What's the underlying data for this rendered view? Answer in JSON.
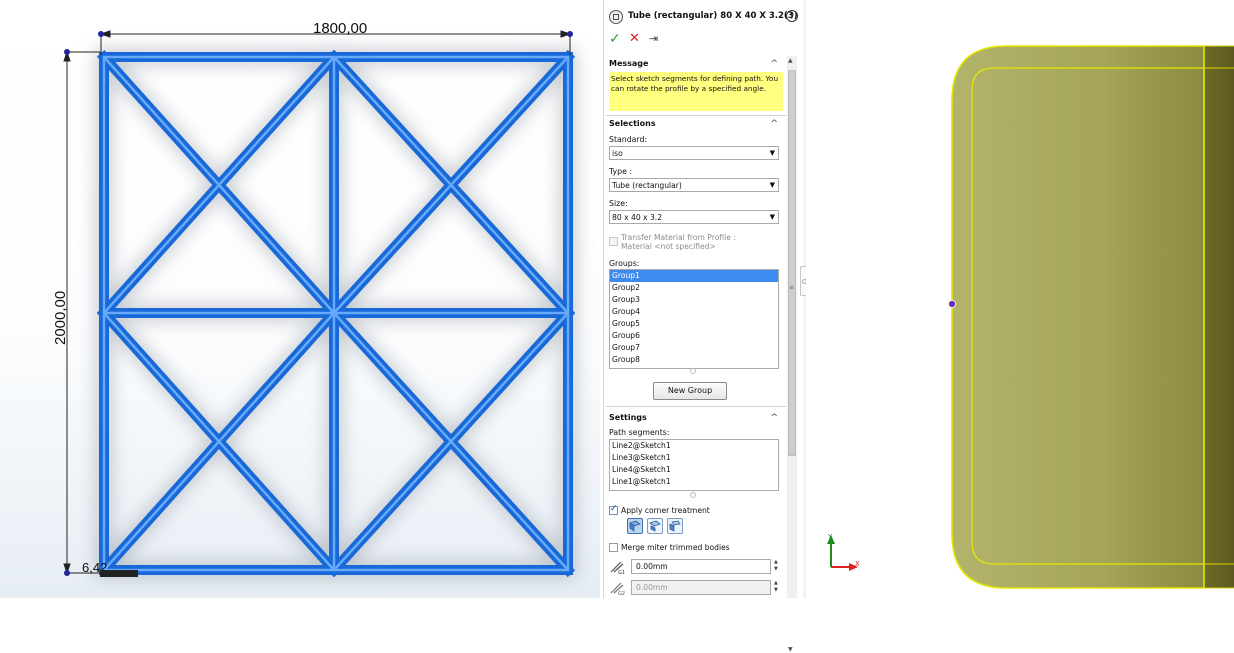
{
  "left_view": {
    "dimension_width": "1800,00",
    "dimension_height": "2000,00",
    "dimension_small": "6,42"
  },
  "property_manager": {
    "title": "Tube (rectangular) 80 X 40 X 3.2(3)",
    "help_symbol": "?",
    "ok_symbol": "✓",
    "cancel_symbol": "✕",
    "pin_symbol": "⇥",
    "message": {
      "heading": "Message",
      "text": "Select sketch segments for defining path. You can rotate the profile by a specified angle."
    },
    "selections": {
      "heading": "Selections",
      "standard_label": "Standard:",
      "standard_value": "iso",
      "type_label": "Type :",
      "type_value": "Tube (rectangular)",
      "size_label": "Size:",
      "size_value": "80 x 40 x 3.2",
      "transfer_material_label": "Transfer Material from Profile :",
      "transfer_material_sub": "Material <not specified>",
      "groups_label": "Groups:",
      "groups": [
        "Group1",
        "Group2",
        "Group3",
        "Group4",
        "Group5",
        "Group6",
        "Group7",
        "Group8"
      ],
      "selected_group": "Group1",
      "new_group_label": "New Group"
    },
    "settings": {
      "heading": "Settings",
      "path_segments_label": "Path segments:",
      "path_segments": [
        "Line2@Sketch1",
        "Line3@Sketch1",
        "Line4@Sketch1",
        "Line1@Sketch1"
      ],
      "apply_corner_label": "Apply corner treatment",
      "apply_corner_checked": true,
      "merge_miter_label": "Merge miter trimmed bodies",
      "merge_miter_checked": false,
      "gap1_value": "0.00mm",
      "gap2_value": "0.00mm"
    }
  },
  "right_view": {
    "axis_x": "X",
    "axis_y": "Y"
  },
  "colors": {
    "member_blue": "#1e6fe0",
    "message_yellow": "#ffff80",
    "profile_fill": "#a8a85a",
    "profile_edge": "#e8e800",
    "selected_blue": "#3c8cf0"
  }
}
